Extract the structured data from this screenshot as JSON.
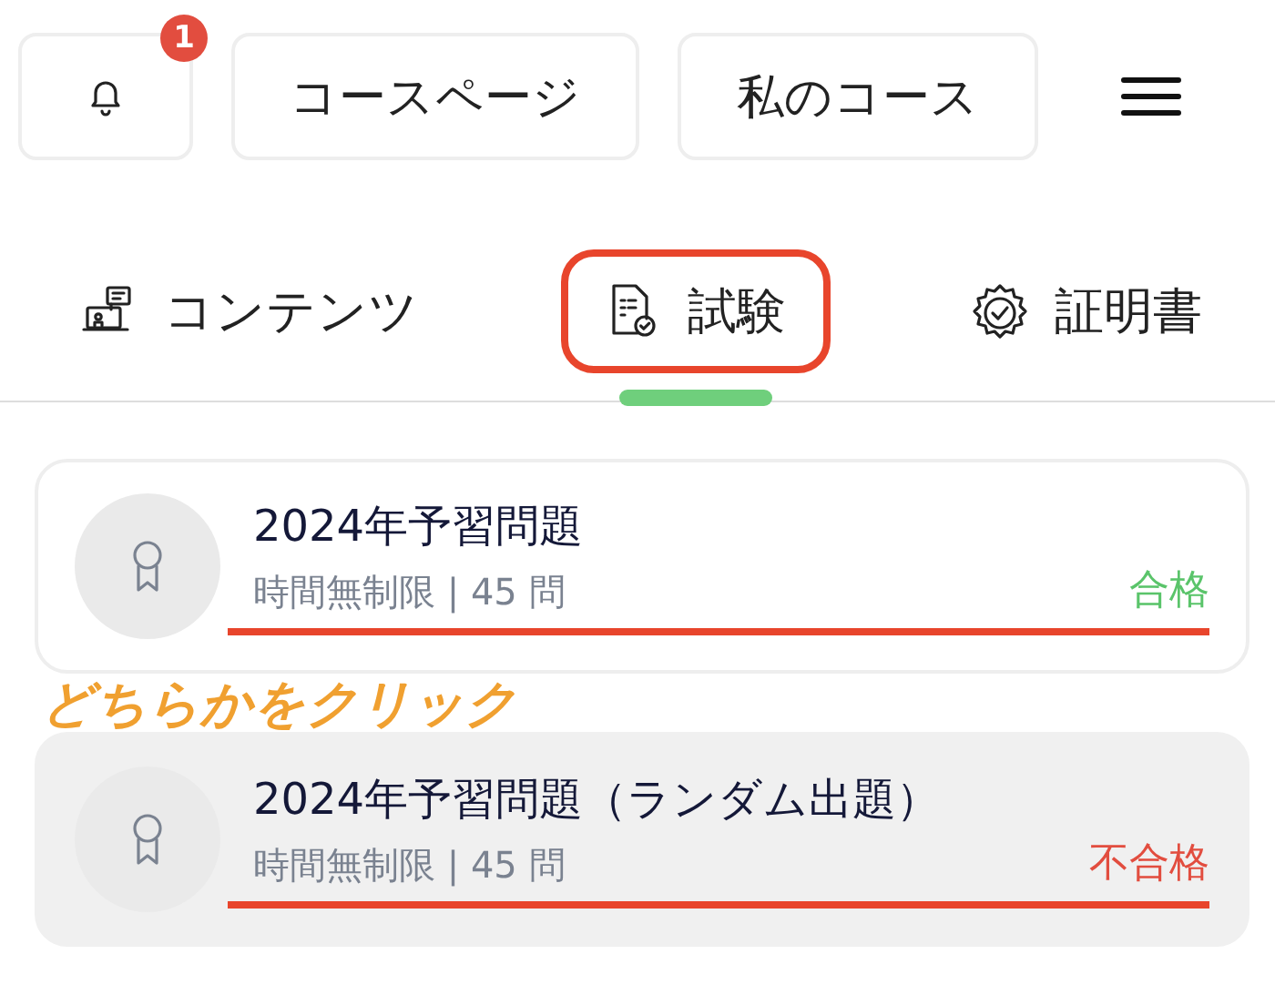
{
  "header": {
    "notification_count": "1",
    "buttons": [
      "コースページ",
      "私のコース"
    ]
  },
  "tabs": [
    {
      "label": "コンテンツ",
      "selected": false
    },
    {
      "label": "試験",
      "selected": true
    },
    {
      "label": "証明書",
      "selected": false
    }
  ],
  "exams": [
    {
      "title": "2024年予習問題",
      "meta": "時間無制限 | 45 問",
      "result": "合格",
      "passed": true,
      "selected": false
    },
    {
      "title": "2024年予習問題（ランダム出題）",
      "meta": "時間無制限 | 45 問",
      "result": "不合格",
      "passed": false,
      "selected": true
    }
  ],
  "annotation": {
    "text": "どちらかをクリック"
  }
}
